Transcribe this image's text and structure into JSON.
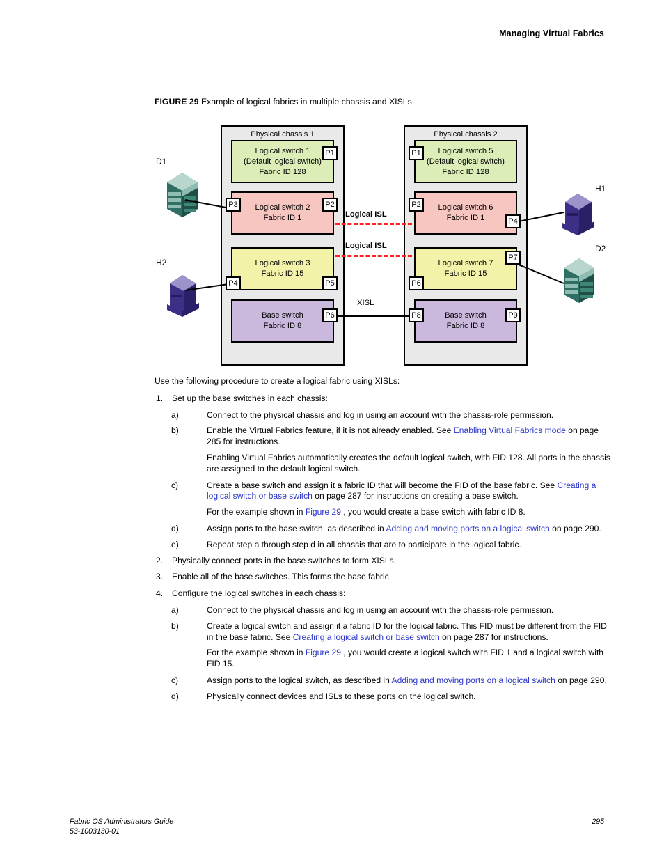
{
  "header": {
    "running_head": "Managing Virtual Fabrics"
  },
  "figure": {
    "caption_label": "FIGURE 29",
    "caption_text": "Example of logical fabrics in multiple chassis and XISLs",
    "chassis1": {
      "title": "Physical chassis 1",
      "switches": [
        {
          "name": "Logical switch 1",
          "sub": "(Default logical switch)",
          "fid": "Fabric ID 128",
          "color": "#dcedb8"
        },
        {
          "name": "Logical switch 2",
          "sub": "",
          "fid": "Fabric ID 1",
          "color": "#f8c6c0"
        },
        {
          "name": "Logical switch 3",
          "sub": "",
          "fid": "Fabric ID 15",
          "color": "#f2f2a8"
        },
        {
          "name": "Base switch",
          "sub": "",
          "fid": "Fabric ID 8",
          "color": "#cbb8dd"
        }
      ],
      "ports": [
        "P1",
        "P3",
        "P2",
        "P4",
        "P5",
        "P6"
      ]
    },
    "chassis2": {
      "title": "Physical chassis 2",
      "switches": [
        {
          "name": "Logical switch 5",
          "sub": "(Default logical switch)",
          "fid": "Fabric ID 128",
          "color": "#dcedb8"
        },
        {
          "name": "Logical switch 6",
          "sub": "",
          "fid": "Fabric ID 1",
          "color": "#f8c6c0"
        },
        {
          "name": "Logical switch 7",
          "sub": "",
          "fid": "Fabric ID 15",
          "color": "#f2f2a8"
        },
        {
          "name": "Base switch",
          "sub": "",
          "fid": "Fabric ID 8",
          "color": "#cbb8dd"
        }
      ],
      "ports": [
        "P1",
        "P2",
        "P4",
        "P7",
        "P6",
        "P8",
        "P9"
      ]
    },
    "links": {
      "logical_isl_1": "Logical ISL",
      "logical_isl_2": "Logical ISL",
      "xisl": "XISL",
      "isl_color": "#ff2020"
    },
    "devices": [
      {
        "id": "D1",
        "type": "storage"
      },
      {
        "id": "H2",
        "type": "host"
      },
      {
        "id": "H1",
        "type": "host"
      },
      {
        "id": "D2",
        "type": "storage"
      }
    ]
  },
  "body": {
    "intro": "Use the following procedure to create a logical fabric using XISLs:",
    "step1_num": "1.",
    "step1": "Set up the base switches in each chassis:",
    "s1a_num": "a)",
    "s1a": "Connect to the physical chassis and log in using an account with the chassis-role permission.",
    "s1b_num": "b)",
    "s1b_pre": "Enable the Virtual Fabrics feature, if it is not already enabled. See ",
    "s1b_link": "Enabling Virtual Fabrics mode",
    "s1b_post": " on page 285 for instructions.",
    "s1b_cont": "Enabling Virtual Fabrics automatically creates the default logical switch, with FID 128. All ports in the chassis are assigned to the default logical switch.",
    "s1c_num": "c)",
    "s1c_pre": "Create a base switch and assign it a fabric ID that will become the FID of the base fabric. See ",
    "s1c_link": "Creating a logical switch or base switch",
    "s1c_post": " on page 287 for instructions on creating a base switch.",
    "s1c_cont_pre": "For the example shown in ",
    "s1c_cont_link": "Figure 29",
    "s1c_cont_post": " , you would create a base switch with fabric ID 8.",
    "s1d_num": "d)",
    "s1d_pre": "Assign ports to the base switch, as described in ",
    "s1d_link": "Adding and moving ports on a logical switch",
    "s1d_post": " on page 290.",
    "s1e_num": "e)",
    "s1e": "Repeat step a through step d in all chassis that are to participate in the logical fabric.",
    "step2_num": "2.",
    "step2": "Physically connect ports in the base switches to form XISLs.",
    "step3_num": "3.",
    "step3": "Enable all of the base switches. This forms the base fabric.",
    "step4_num": "4.",
    "step4": "Configure the logical switches in each chassis:",
    "s4a_num": "a)",
    "s4a": "Connect to the physical chassis and log in using an account with the chassis-role permission.",
    "s4b_num": "b)",
    "s4b_pre": "Create a logical switch and assign it a fabric ID for the logical fabric. This FID must be different from the FID in the base fabric. See ",
    "s4b_link": "Creating a logical switch or base switch",
    "s4b_post": " on page 287 for instructions.",
    "s4b_cont_pre": "For the example shown in ",
    "s4b_cont_link": "Figure 29",
    "s4b_cont_post": " , you would create a logical switch with FID 1 and a logical switch with FID 15.",
    "s4c_num": "c)",
    "s4c_pre": "Assign ports to the logical switch, as described in ",
    "s4c_link": "Adding and moving ports on a logical switch",
    "s4c_post": " on page 290.",
    "s4d_num": "d)",
    "s4d": "Physically connect devices and ISLs to these ports on the logical switch."
  },
  "footer": {
    "guide": "Fabric OS Administrators Guide",
    "docnum": "53-1003130-01",
    "page": "295"
  }
}
